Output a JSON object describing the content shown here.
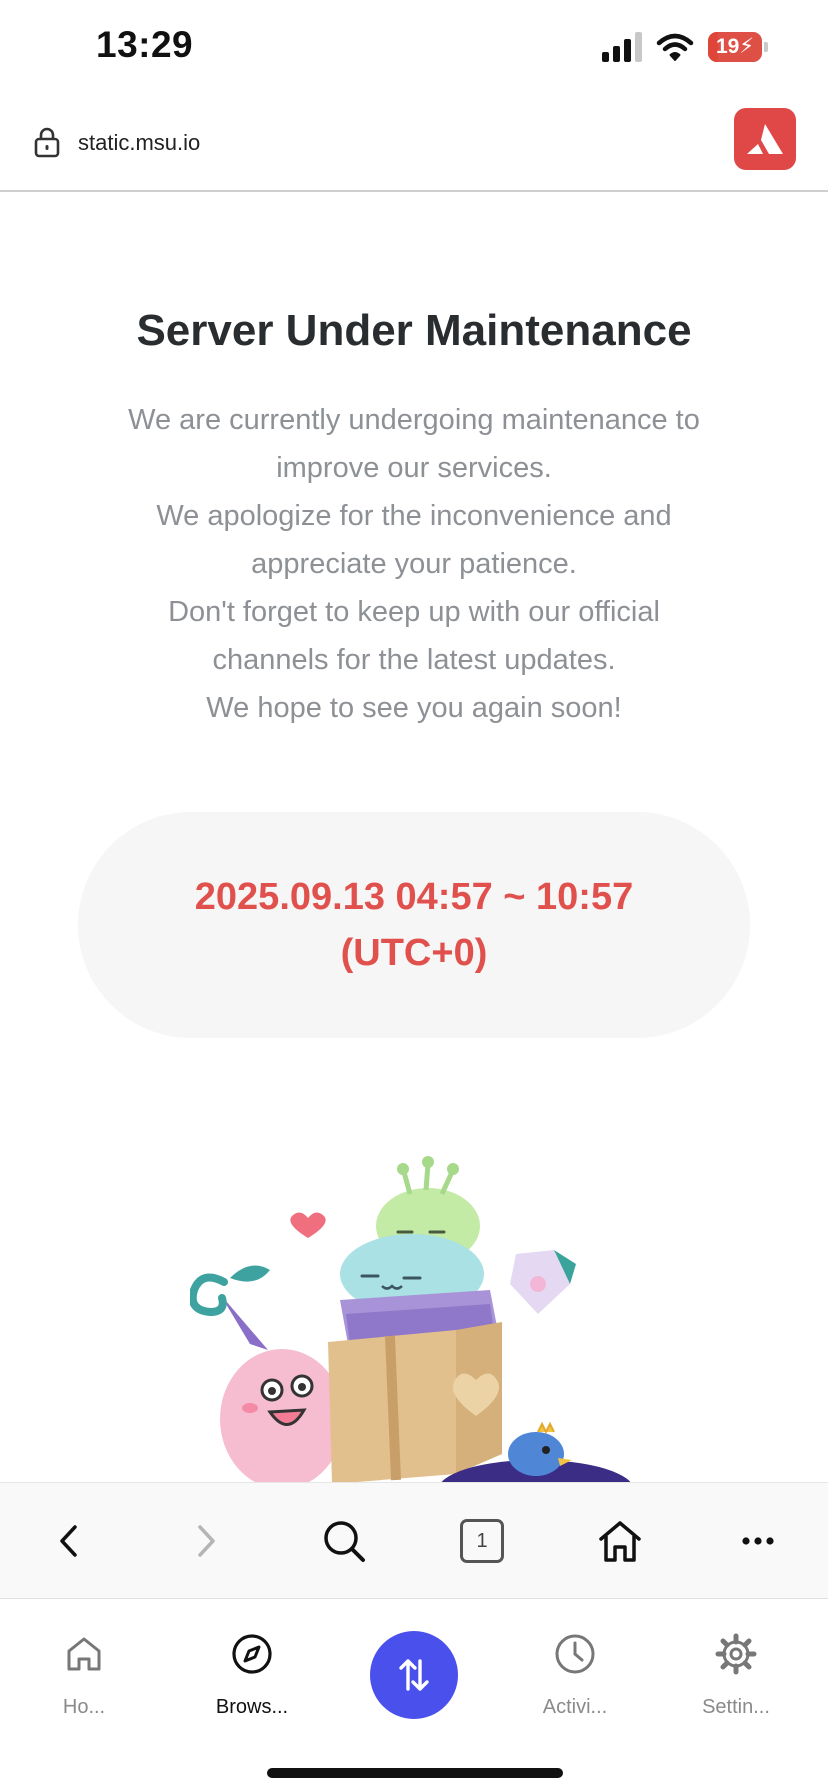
{
  "status_bar": {
    "time": "13:29",
    "battery_level": "19"
  },
  "url_bar": {
    "url": "static.msu.io"
  },
  "page": {
    "title": "Server Under Maintenance",
    "message_lines": [
      "We are currently undergoing maintenance to",
      "improve our services.",
      "We apologize for the inconvenience and",
      "appreciate your patience.",
      "Don't forget to keep up with our official",
      "channels for the latest updates.",
      "We hope to see you again soon!"
    ],
    "maintenance_window": "2025.09.13 04:57 ~ 10:57",
    "timezone": "(UTC+0)"
  },
  "browser_toolbar": {
    "tab_count": "1"
  },
  "bottom_nav": {
    "items": [
      {
        "label": "Ho...",
        "icon": "home-icon"
      },
      {
        "label": "Brows...",
        "icon": "compass-icon"
      },
      {
        "label": "Activi...",
        "icon": "clock-icon"
      },
      {
        "label": "Settin...",
        "icon": "gear-icon"
      }
    ],
    "active": "Brows..."
  },
  "colors": {
    "accent_red": "#e0514e",
    "swap_blue": "#4a50ec",
    "wallet_logo_red": "#e04848"
  }
}
